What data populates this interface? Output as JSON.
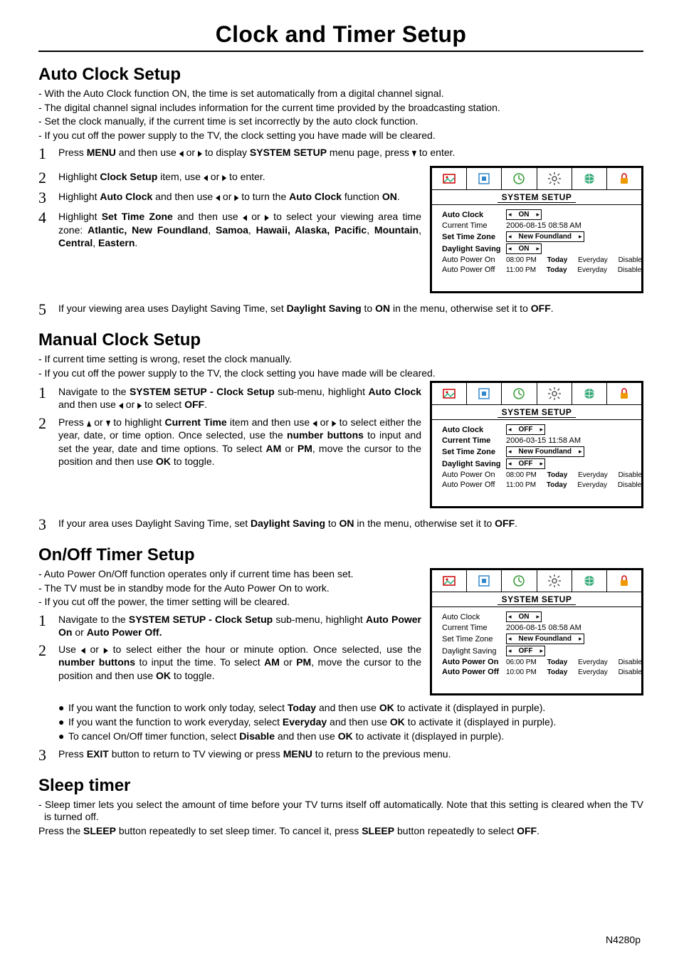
{
  "title": "Clock and Timer Setup",
  "footer": "N4280p",
  "autoClock": {
    "heading": "Auto Clock Setup",
    "leads": [
      "- With the Auto Clock function ON, the time is set automatically from a digital channel signal.",
      "- The digital channel signal includes information for the current time provided by the broadcasting station.",
      "- Set the clock manually, if the current time is set incorrectly by the auto clock function.",
      "- If you cut off the power supply to the TV, the clock setting you have made will be cleared."
    ],
    "step1": {
      "n": "1",
      "html": "Press <b>MENU</b> and then use <span class='arrow'>◂</span> or <span class='arrow'>▸</span> to display <b>SYSTEM SETUP</b> menu page, press <span class='arrow'>▾</span> to enter."
    },
    "step2": {
      "n": "2",
      "html": "Highlight <b>Clock Setup</b> item, use <span class='arrow'>◂</span> or <span class='arrow'>▸</span> to enter."
    },
    "step3": {
      "n": "3",
      "html": "Highlight <b>Auto Clock</b> and then use <span class='arrow'>◂</span> or <span class='arrow'>▸</span> to turn the <b>Auto Clock</b> function <b>ON</b>."
    },
    "step4": {
      "n": "4",
      "html": "Highlight <b>Set Time Zone</b> and then use <span class='arrow'>◂</span> or <span class='arrow'>▸</span> to select your viewing area time zone: <b>Atlantic, New Foundland</b>, <b>Samoa</b>, <b>Hawaii, Alaska, Pacific</b>, <b>Mountain</b>, <b>Central</b>, <b>Eastern</b>."
    },
    "step5": {
      "n": "5",
      "html": "If your viewing area uses Daylight Saving Time, set <b>Daylight Saving</b> to <b>ON</b> in the menu, otherwise set it to <b>OFF</b>."
    }
  },
  "manualClock": {
    "heading": "Manual Clock Setup",
    "leads": [
      "- If current time setting is wrong, reset the clock manually.",
      "- If you cut off the power supply to the TV, the clock setting you have made will be cleared."
    ],
    "step1": {
      "n": "1",
      "html": "Navigate to the <b>SYSTEM SETUP - Clock Setup</b> sub-menu, highlight <b>Auto Clock</b> and then use <span class='arrow'>◂</span> or <span class='arrow'>▸</span> to select <b>OFF</b>."
    },
    "step2": {
      "n": "2",
      "html": "Press <span class='arrow'>▴</span> or <span class='arrow'>▾</span> to highlight <b>Current Time</b> item and then use <span class='arrow'>◂</span> or <span class='arrow'>▸</span> to select either the year, date, or time option. Once selected, use the <b>number buttons</b> to input and set the year, date and time options. To select <b>AM</b> or <b>PM</b>, move the cursor to the position and then use <b>OK</b> to toggle."
    },
    "step3": {
      "n": "3",
      "html": "If your area uses Daylight Saving Time, set <b>Daylight Saving</b> to <b>ON</b> in the menu, otherwise set it to <b>OFF</b>."
    }
  },
  "timer": {
    "heading": "On/Off Timer Setup",
    "leads": [
      "- Auto Power On/Off function operates only if current time has been set.",
      "- The TV must be in standby mode for the Auto Power On to work.",
      "- If you cut off the power, the timer setting will be cleared."
    ],
    "step1": {
      "n": "1",
      "html": "Navigate to the <b>SYSTEM SETUP - Clock Setup</b> sub-menu, highlight <b>Auto Power On</b> or <b>Auto Power Off.</b>"
    },
    "step2": {
      "n": "2",
      "html": "Use <span class='arrow'>◂</span> or <span class='arrow'>▸</span> to select either the hour or minute option. Once selected, use the <b>number buttons</b> to input the time. To select <b>AM</b> or <b>PM</b>, move the cursor to the position and then use <b>OK</b> to toggle."
    },
    "bullets": [
      "If you want the function to work only today, select <b>Today</b> and then use <b>OK</b> to activate it (displayed in purple).",
      "If you want the function to work everyday, select <b>Everyday</b> and then use <b>OK</b> to activate it (displayed in purple).",
      "To cancel On/Off timer function, select <b>Disable</b> and then use <b>OK</b> to activate it (displayed in purple)."
    ],
    "step3": {
      "n": "3",
      "html": "Press <b>EXIT</b> button to return to TV viewing or press <b>MENU</b> to return to the previous menu."
    }
  },
  "sleep": {
    "heading": "Sleep timer",
    "leads": [
      "- Sleep timer lets you select the amount of time before your TV turns itself off automatically. Note that this setting is cleared when the TV is turned off."
    ],
    "line": "Press the <b>SLEEP</b> button repeatedly to set sleep timer. To cancel it, press <b>SLEEP</b> button repeatedly to select <b>OFF</b>."
  },
  "osd": {
    "title": "SYSTEM SETUP",
    "labels": {
      "autoClock": "Auto Clock",
      "currentTime": "Current Time",
      "setTimeZone": "Set Time Zone",
      "daylightSaving": "Daylight Saving",
      "autoPowerOn": "Auto Power On",
      "autoPowerOff": "Auto Power Off"
    },
    "values": {
      "on": "ON",
      "off": "OFF",
      "newFoundland": "New Foundland",
      "time1": "2006-08-15  08:58  AM",
      "time2": "2006-03-15  11:58  AM",
      "pwrOn1": "08:00 PM",
      "pwrOff1": "11:00 PM",
      "pwrOn3": "06:00 PM",
      "pwrOff3": "10:00 PM",
      "today": "Today",
      "everyday": "Everyday",
      "disable": "Disable"
    }
  }
}
